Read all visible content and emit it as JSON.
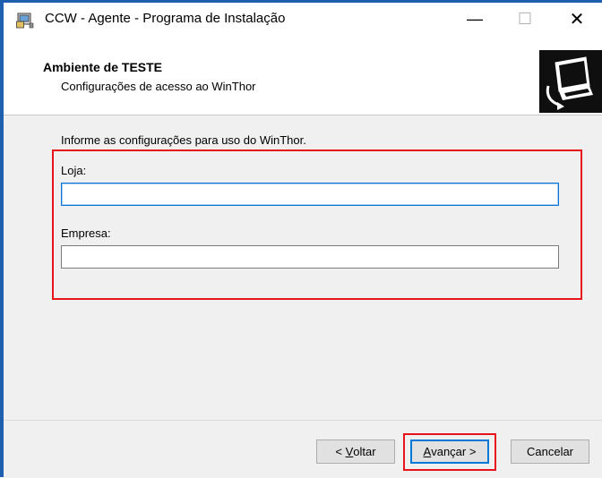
{
  "window": {
    "title": "CCW - Agente - Programa de Instalação",
    "minimize_glyph": "—",
    "maximize_glyph": "☐",
    "close_glyph": "✕",
    "app_icon": "installer-icon"
  },
  "header": {
    "title": "Ambiente de TESTE",
    "subtitle": "Configurações de acesso ao WinThor",
    "image_icon": "computer-install-icon"
  },
  "body": {
    "info_text": "Informe as configurações para uso do WinThor.",
    "loja_label": "Loja:",
    "loja_value": "",
    "empresa_label": "Empresa:",
    "empresa_value": ""
  },
  "buttons": {
    "back_prefix": "< ",
    "back_accel": "V",
    "back_rest": "oltar",
    "next_accel": "A",
    "next_rest": "vançar >",
    "cancel": "Cancelar"
  },
  "highlight_color": "#e8141c",
  "accent_color": "#1f5fb0"
}
